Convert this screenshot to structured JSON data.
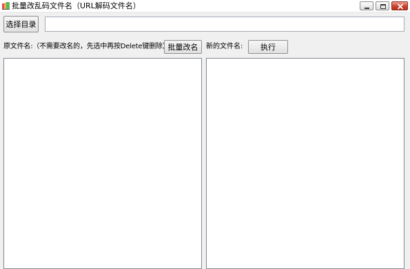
{
  "window": {
    "title": "批量改乱码文件名（URL解码文件名）",
    "app_icon": "app-icon"
  },
  "toolbar": {
    "select_dir_label": "选择目录",
    "dir_path_value": ""
  },
  "labels": {
    "original_names": "原文件名:（不需要改名的，先选中再按Delete键删除）",
    "new_names": "新的文件名:"
  },
  "buttons": {
    "batch_rename": "批量改名",
    "execute": "执行"
  },
  "lists": {
    "original_files": [],
    "new_files": []
  }
}
